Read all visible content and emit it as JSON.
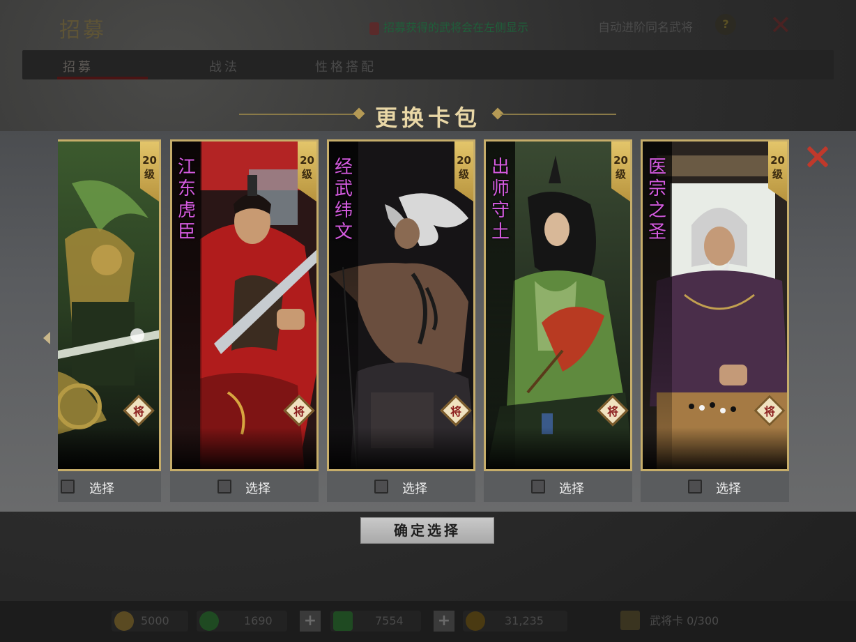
{
  "background": {
    "title": "招募",
    "notice": "招募获得的武将会在左侧显示",
    "auto_label": "自动进阶同名武将",
    "tabs": [
      {
        "label": "招募",
        "active": true
      },
      {
        "label": "战法",
        "active": false
      },
      {
        "label": "性格搭配",
        "active": false
      }
    ],
    "resources": [
      {
        "name": "jade",
        "value": "5000"
      },
      {
        "name": "copper",
        "value": "1690"
      },
      {
        "name": "recruit-token",
        "value": "7554"
      },
      {
        "name": "gold",
        "value": "31,235"
      }
    ],
    "card_count_label": "武将卡 0/300"
  },
  "modal": {
    "title": "更换卡包",
    "confirm_label": "确定选择",
    "select_label": "选择",
    "cards": [
      {
        "name": "",
        "level": "20",
        "level_unit": "级",
        "badge": "将",
        "selected": false,
        "art": "green-general"
      },
      {
        "name": "江东虎臣",
        "level": "20",
        "level_unit": "级",
        "badge": "将",
        "selected": false,
        "art": "red-general"
      },
      {
        "name": "经武纬文",
        "level": "20",
        "level_unit": "级",
        "badge": "将",
        "selected": false,
        "art": "white-hair-warrior"
      },
      {
        "name": "出师守土",
        "level": "20",
        "level_unit": "级",
        "badge": "将",
        "selected": false,
        "art": "strategist"
      },
      {
        "name": "医宗之圣",
        "level": "20",
        "level_unit": "级",
        "badge": "将",
        "selected": false,
        "art": "elder-go-player"
      }
    ]
  },
  "colors": {
    "accent_gold": "#c6ad6a",
    "name_purple": "#d55be0",
    "close_red": "#c0392b"
  }
}
